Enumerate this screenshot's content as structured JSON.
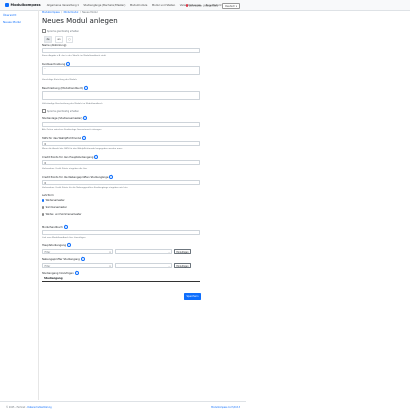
{
  "app": {
    "brand": "Modulkompass"
  },
  "nav": {
    "items": [
      "Allgemeine Verwaltung ▾",
      "Studiengänge (Bachelor/Master)",
      "Modulmodule",
      "Modul und Stellen",
      "Veranstaltungen",
      "Zug-Modul ▾"
    ],
    "user": "Lehrender (Alexander)",
    "language": "Deutsch ▾"
  },
  "sidebar": {
    "items": [
      "Übersicht",
      "Neues Modul"
    ]
  },
  "breadcrumb": [
    "Modulkompass",
    "Modulmodul",
    "Neues Modul"
  ],
  "page": {
    "title": "Neues Modul anlegen"
  },
  "form": {
    "sync_checkbox": "Sprache gleichzeitig erhalten",
    "lang_tabs": [
      "de",
      "en",
      "◻"
    ],
    "name_label": "Name (Abkürzung)",
    "name_help": "Kurze Angabe z.B. der in der Tabelle im Modulhandbuch steht",
    "kurzbeschreibung_label": "Kurzbeschreibung",
    "kurzbeschreibung_value": "-",
    "kurzbeschreibung_help": "Vorschläge Einteilung des Moduls",
    "beschreibung_label": "Beschreibung (Modulhandbuch)",
    "beschreibung_help": "Vollständige Beschreibung des Moduls im Modulhandbuch",
    "sync_checkbox_2": "Sprache gleichzeitig erhalten",
    "studienlage_label": "Studienlage (Studiensemester)",
    "studienlage_help": "Alle Zeiten zwischen Studienlage Semesterzeit eintragen",
    "sws_label": "SWS für das Wahlpflichtmodul",
    "sws_value": "0",
    "sws_help": "Wenn die Anzahl der SWS für das Wahlpflichtmodul angegeben werden muss",
    "cp_haupt_label": "Credit Points für den Hauptstudiengang",
    "cp_haupt_value": "0",
    "cp_haupt_help": "Vorhandene Credit Points eingeben die hier",
    "cp_fach_label": "Credit Points für die Nebengeprüften Studiengänge",
    "cp_fach_value": "0",
    "cp_fach_help": "Vorhandene Credit Points für die Nebengeprüften Studiengänge eingeben wie hier",
    "lehrform_label": "Lehrform",
    "lehrform_options": [
      "Wintersemester",
      "Sommersemester",
      "Winter- und Sommersemester"
    ],
    "modulhandbuch_label": "Modulhandbuch",
    "modulhandbuch_help": "Link zum Modulhandbuch hier hinzufügen",
    "haupt_label": "Hauptstudiengang",
    "haupt_placeholder": "Filter",
    "neben_label": "Nebengeprüfter Studiengang",
    "neben_placeholder": "Filter",
    "hinzufuegen": "Hinzufügen",
    "studiengang_label": "Studiengang hinzufügen",
    "table_header": "Studiengang",
    "save": "Speichern"
  },
  "footer": {
    "copyright": "© 2025 - Fachnet",
    "datenschutz": "Datenschutzerklärung",
    "version": "Modulkompass 0.2.5/0.8.3"
  },
  "colors": {
    "primary": "#0d6efd",
    "danger": "#dc3545"
  }
}
